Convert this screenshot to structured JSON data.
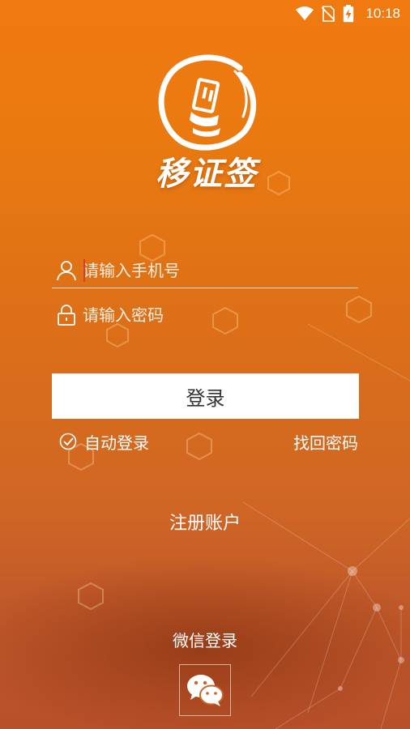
{
  "status_bar": {
    "time": "10:18",
    "icons": [
      "wifi-icon",
      "no-sim-icon",
      "battery-charging-icon"
    ]
  },
  "app": {
    "logo_text": "移证签"
  },
  "login_form": {
    "phone_placeholder": "请输入手机号",
    "password_placeholder": "请输入密码",
    "phone_value": "",
    "password_value": "",
    "login_label": "登录",
    "auto_login_label": "自动登录",
    "auto_login_checked": true,
    "find_password_label": "找回密码"
  },
  "register": {
    "label": "注册账户"
  },
  "wechat": {
    "label": "微信登录",
    "icon": "wechat-icon"
  },
  "colors": {
    "background_top": "#f07a0f",
    "background_bottom": "#b8502a",
    "button_bg": "#ffffff",
    "button_text": "#333333",
    "cursor": "#e23a2a"
  }
}
